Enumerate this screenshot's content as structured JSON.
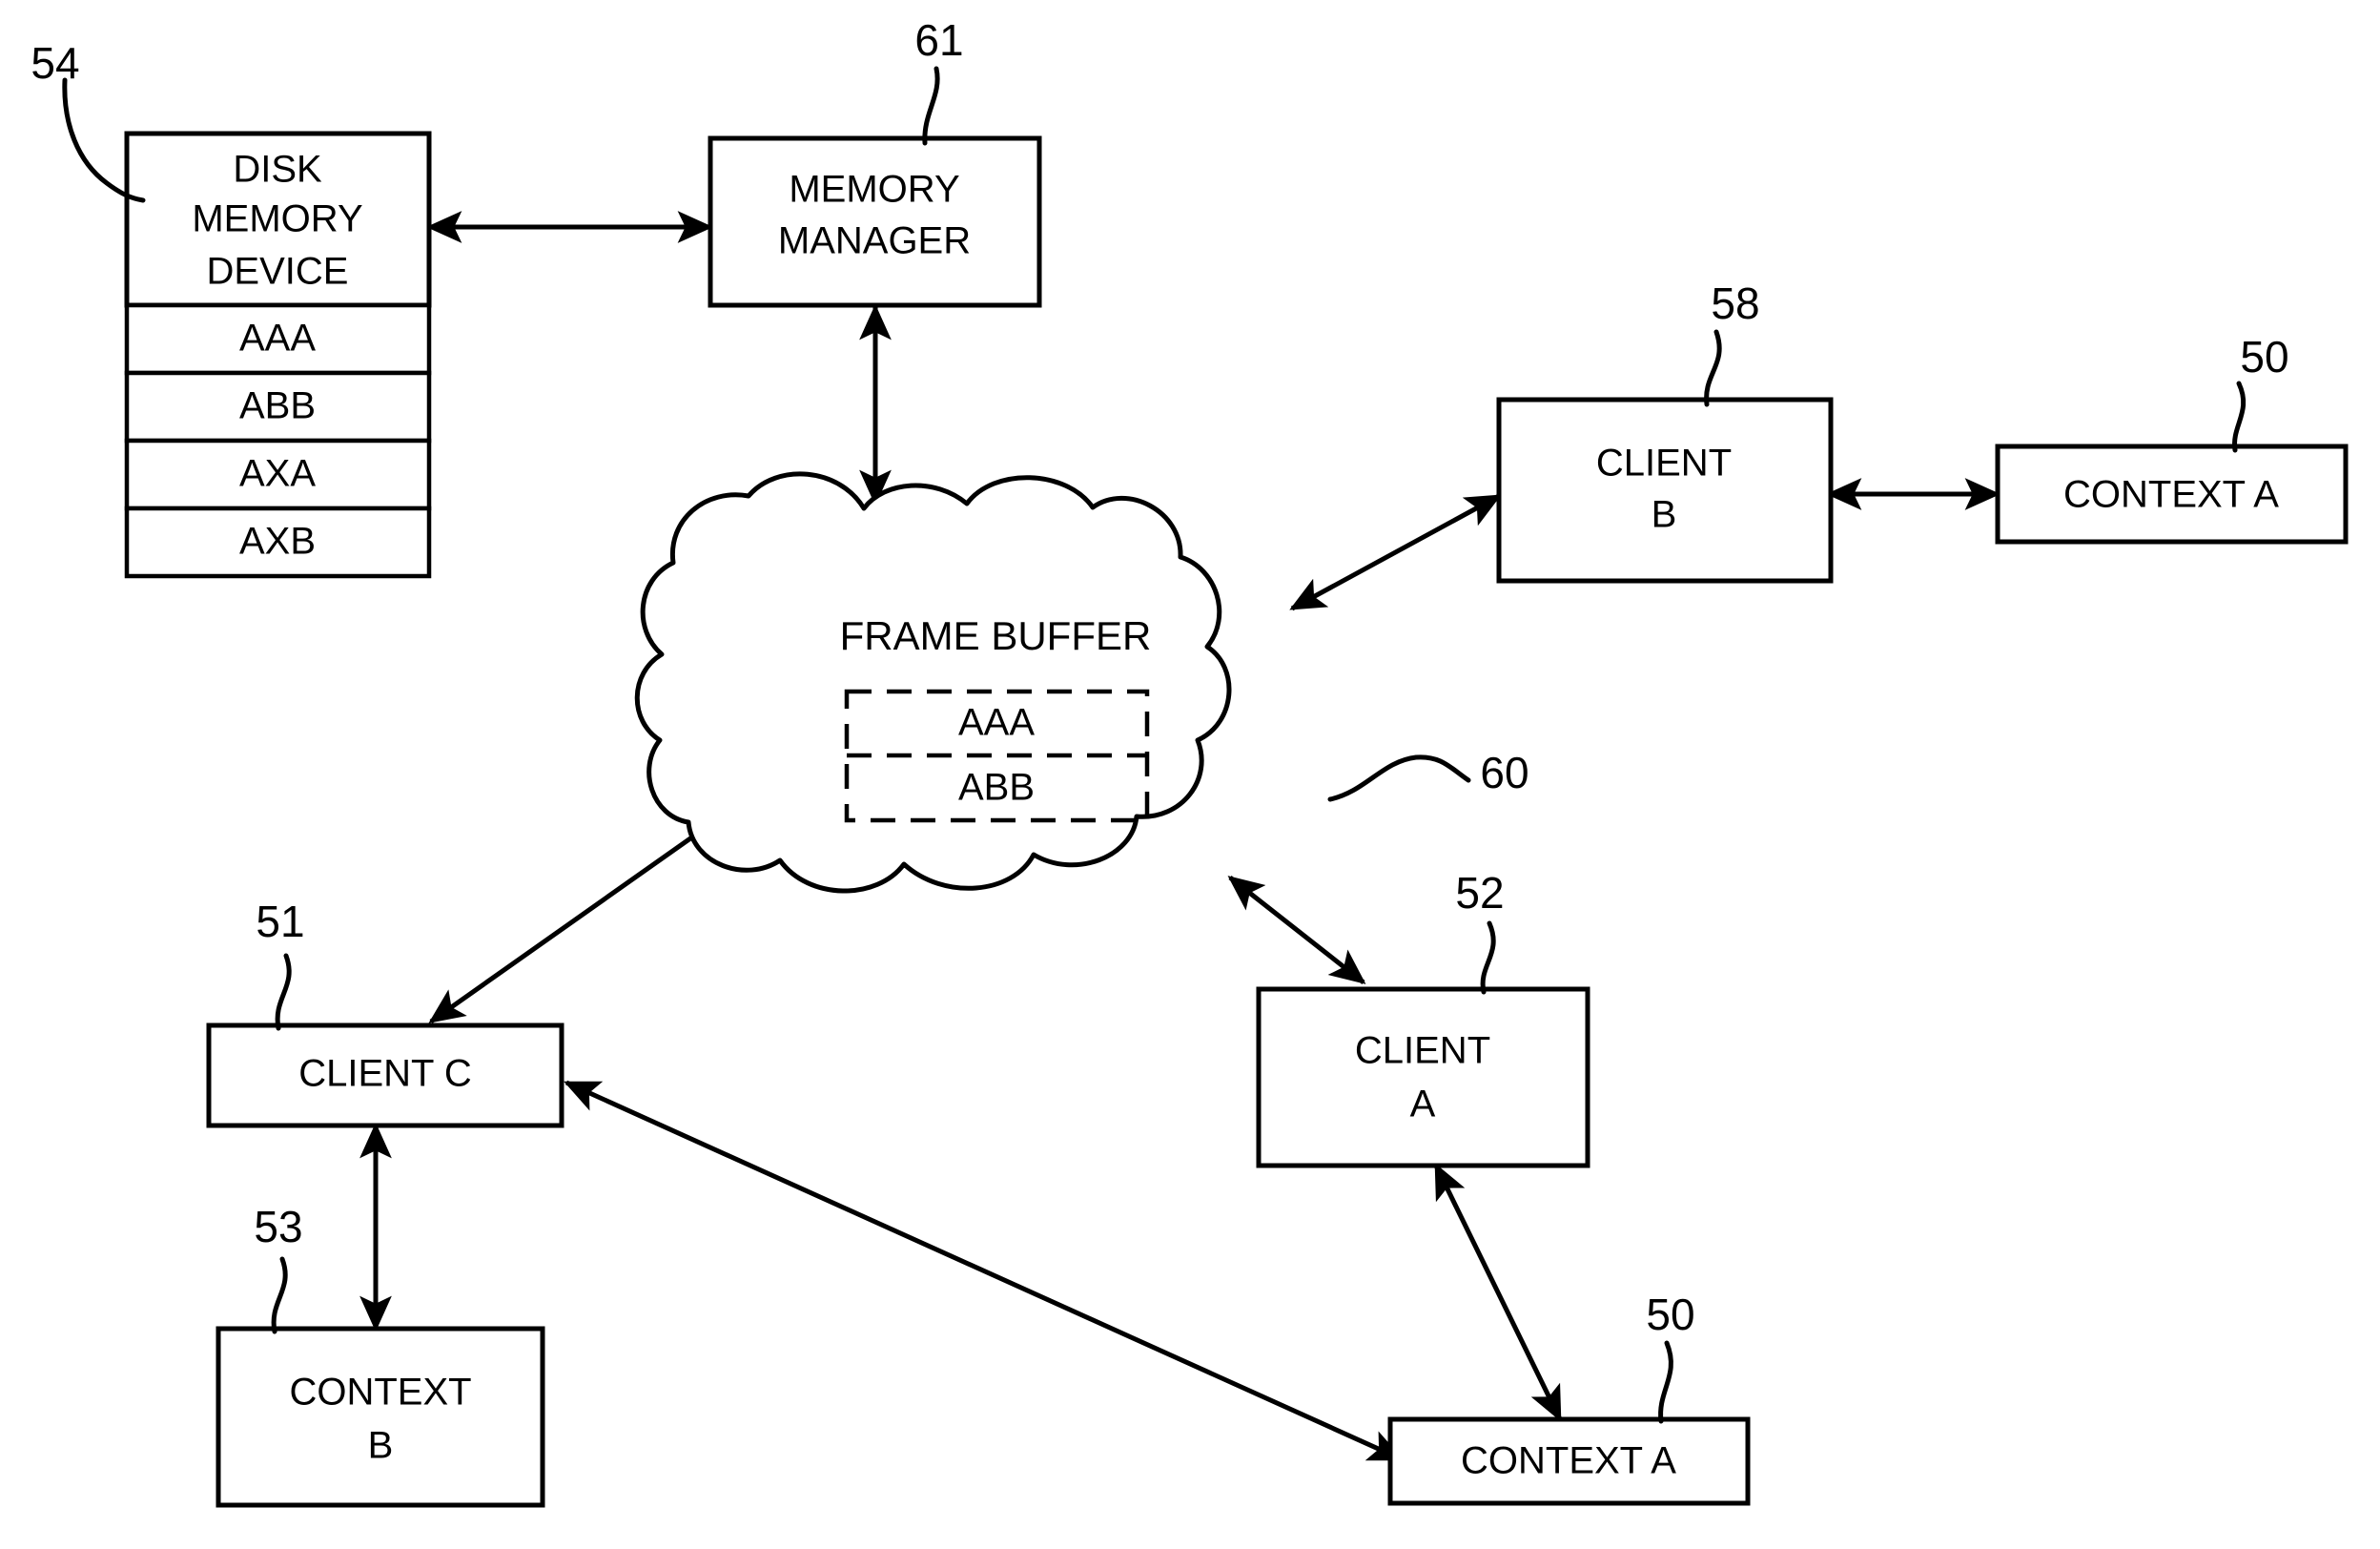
{
  "figure": {
    "type": "patent-block-diagram",
    "background_color": "#ffffff",
    "line_color": "#000000"
  },
  "nodes": {
    "disk_memory": {
      "title_line1": "DISK",
      "title_line2": "MEMORY",
      "title_line3": "DEVICE",
      "ref": "54",
      "rows": [
        "AAA",
        "ABB",
        "AXA",
        "AXB"
      ]
    },
    "memory_manager": {
      "line1": "MEMORY",
      "line2": "MANAGER",
      "ref": "61"
    },
    "frame_buffer": {
      "title": "FRAME BUFFER",
      "ref": "60",
      "rows": [
        "AAA",
        "ABB"
      ]
    },
    "client_b": {
      "line1": "CLIENT",
      "line2": "B",
      "ref": "58"
    },
    "context_a_right": {
      "label": "CONTEXT A",
      "ref": "50"
    },
    "client_c": {
      "label": "CLIENT C",
      "ref": "51"
    },
    "context_b": {
      "line1": "CONTEXT",
      "line2": "B",
      "ref": "53"
    },
    "client_a": {
      "line1": "CLIENT",
      "line2": "A",
      "ref": "52"
    },
    "context_a_bottom": {
      "label": "CONTEXT A",
      "ref": "50"
    }
  },
  "connections": [
    {
      "name": "disk-memory-to-memory-manager",
      "from": "disk_memory",
      "to": "memory_manager",
      "arrows": "both"
    },
    {
      "name": "memory-manager-to-frame-buffer",
      "from": "memory_manager",
      "to": "frame_buffer",
      "arrows": "both"
    },
    {
      "name": "frame-buffer-to-client-b",
      "from": "frame_buffer",
      "to": "client_b",
      "arrows": "both"
    },
    {
      "name": "client-b-to-context-a-right",
      "from": "client_b",
      "to": "context_a_right",
      "arrows": "both"
    },
    {
      "name": "frame-buffer-to-client-c",
      "from": "frame_buffer",
      "to": "client_c",
      "arrows": "both"
    },
    {
      "name": "frame-buffer-to-client-a",
      "from": "frame_buffer",
      "to": "client_a",
      "arrows": "both"
    },
    {
      "name": "client-c-to-context-b",
      "from": "client_c",
      "to": "context_b",
      "arrows": "both"
    },
    {
      "name": "client-a-to-context-a-bottom",
      "from": "client_a",
      "to": "context_a_bottom",
      "arrows": "both"
    },
    {
      "name": "context-a-bottom-to-client-c",
      "from": "context_a_bottom",
      "to": "client_c",
      "arrows": "both"
    }
  ]
}
